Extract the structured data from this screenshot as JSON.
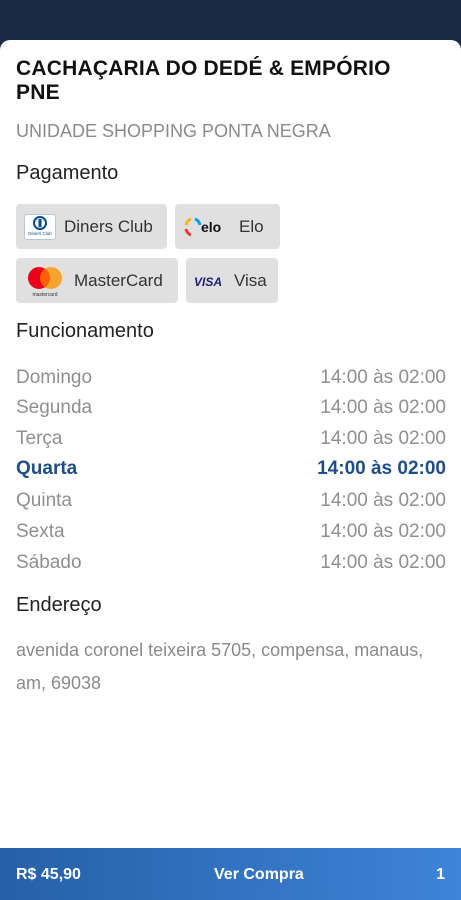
{
  "store": {
    "title": "CACHAÇARIA DO DEDÉ & EMPÓRIO PNE",
    "unit": "UNIDADE SHOPPING PONTA NEGRA"
  },
  "payment": {
    "heading": "Pagamento",
    "methods": [
      {
        "label": "Diners Club",
        "icon": "diners-club-icon",
        "logo_text": "Diners Club"
      },
      {
        "label": "Elo",
        "icon": "elo-icon",
        "logo_text": "elo"
      },
      {
        "label": "MasterCard",
        "icon": "mastercard-icon",
        "logo_text": "mastercard"
      },
      {
        "label": "Visa",
        "icon": "visa-icon",
        "logo_text": "VISA"
      }
    ]
  },
  "hours": {
    "heading": "Funcionamento",
    "days": [
      {
        "day": "Domingo",
        "time": "14:00 às 02:00"
      },
      {
        "day": "Segunda",
        "time": "14:00 às 02:00"
      },
      {
        "day": "Terça",
        "time": "14:00 às 02:00"
      },
      {
        "day": "Quarta",
        "time": "14:00 às 02:00",
        "current": true
      },
      {
        "day": "Quinta",
        "time": "14:00 às 02:00"
      },
      {
        "day": "Sexta",
        "time": "14:00 às 02:00"
      },
      {
        "day": "Sábado",
        "time": "14:00 às 02:00"
      }
    ]
  },
  "address": {
    "heading": "Endereço",
    "text": "avenida coronel teixeira 5705, compensa, manaus, am, 69038"
  },
  "cart": {
    "total": "R$ 45,90",
    "action": "Ver Compra",
    "count": "1"
  },
  "colors": {
    "accent": "#1d4e89",
    "bar_start": "#2660a8",
    "bar_end": "#3e84d8",
    "header_bg": "#1b2a44"
  }
}
